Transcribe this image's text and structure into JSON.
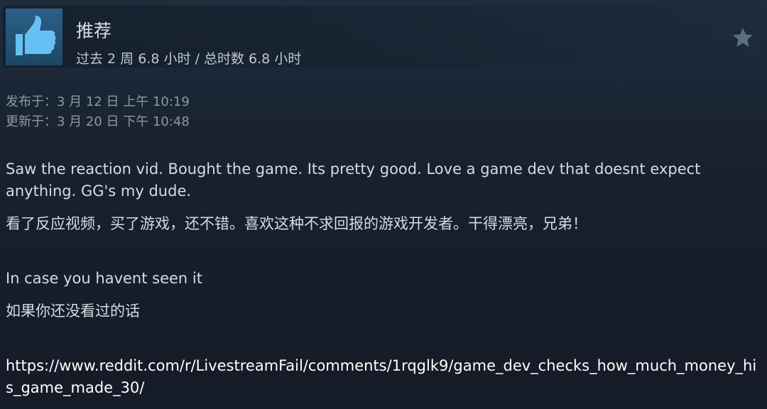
{
  "header": {
    "verdict": "推荐",
    "hours": "过去 2 周 6.8 小时 / 总时数 6.8 小时",
    "thumb_icon": "thumbs-up-icon",
    "award_icon": "award-star-icon",
    "colors": {
      "thumb_background": "#2c5f87",
      "thumb_foreground": "#66c0f4"
    }
  },
  "dates": {
    "posted": "发布于：3 月 12 日 上午 10:19",
    "updated": "更新于：3 月 20 日 下午 10:48"
  },
  "content": {
    "paragraph_en_1": "Saw the reaction vid. Bought the game. Its pretty good. Love a game dev that doesnt expect anything. GG's my dude.",
    "paragraph_zh_1": "看了反应视频，买了游戏，还不错。喜欢这种不求回报的游戏开发者。干得漂亮，兄弟！",
    "paragraph_en_2": "In case you havent seen it",
    "paragraph_zh_2": "如果你还没看过的话",
    "link": "https://www.reddit.com/r/LivestreamFail/comments/1rqglk9/game_dev_checks_how_much_money_his_game_made_30/"
  }
}
